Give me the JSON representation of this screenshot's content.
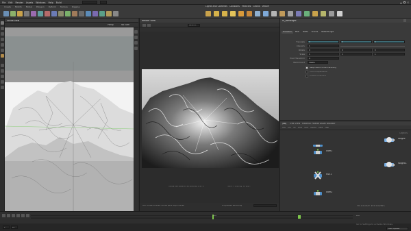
{
  "menubar": {
    "items": [
      "File",
      "Edit",
      "Render",
      "Assets",
      "Windows",
      "Help",
      "Build"
    ]
  },
  "shelf": {
    "tabs": [
      "Create",
      "Modify",
      "Model",
      "Polygon",
      "Deform",
      "Texture",
      "Rigging"
    ],
    "right_tabs": [
      "Lights and Cameras",
      "Collisions",
      "Particles",
      "Grains",
      "Vellum"
    ]
  },
  "scene_viewer": {
    "tab": "Scene View",
    "persp_label": "Persp",
    "cam_label": "No cam"
  },
  "render_view": {
    "tab": "Render View",
    "rop_label": "Redshift",
    "status": "Frame 120 2024-07-10 22:48:42 0:17 s",
    "render_info": "Stats: 3 Loading: 16 spp...",
    "bottom_hint": "Left mouse tumbles. Middle pans. Right dollies.",
    "progress_label": "Progressive Rendering"
  },
  "parameters": {
    "node_name": "rs_domelight",
    "tabs": [
      "Transform",
      "Main",
      "Matte",
      "Volume",
      "Redshift Light"
    ],
    "rows": [
      {
        "label": "Translate",
        "values": [
          "0",
          "0",
          "0"
        ]
      },
      {
        "label": "Intensity",
        "values": [
          "1"
        ]
      },
      {
        "label": "Rotate",
        "values": [
          "0",
          "0",
          "0"
        ]
      },
      {
        "label": "Scale",
        "values": [
          "1",
          "1",
          "1"
        ]
      },
      {
        "label": "Pivot Transform",
        "values": [
          "0"
        ]
      },
      {
        "label": "Background",
        "values": [
          "Visible"
        ]
      }
    ],
    "checks": [
      {
        "label": "Keep Position When Parenting",
        "checked": true
      },
      {
        "label": "Child Compensation",
        "checked": false
      },
      {
        "label": "Enable Constraints",
        "checked": false
      }
    ]
  },
  "network": {
    "tabs": [
      "/obj",
      "Tree View",
      "Material Palette",
      "Asset Browser"
    ],
    "path": "obj",
    "menu": [
      "Add",
      "Edit",
      "Go",
      "View",
      "Tools",
      "Layout",
      "Labs",
      "Help"
    ],
    "nodes": [
      {
        "name": "cam1",
        "sub": "",
        "color": "#4f8fc9"
      },
      {
        "name": "null1",
        "sub": "",
        "color": "#4f8fc9"
      },
      {
        "name": "cam2",
        "sub": "",
        "color": "#4f8fc9"
      },
      {
        "name": "rslight",
        "sub": "",
        "color": "#7ab0e6"
      },
      {
        "name": "rslight1",
        "sub": "",
        "color": "#7ab0e6"
      }
    ],
    "context_label": "Objects"
  },
  "timeline": {
    "start": "1",
    "end": "240",
    "current": "120",
    "fps_label": "24",
    "status": "Auto Update"
  },
  "watermark": {
    "line1": "Activate Windows",
    "line2": "Go to Settings to activate Windows."
  },
  "colors": {
    "accent_green": "#7ec84b",
    "accent_blue": "#4f8fc9",
    "accent_yellow": "#d6b24a",
    "bg": "#2b2b2b"
  }
}
